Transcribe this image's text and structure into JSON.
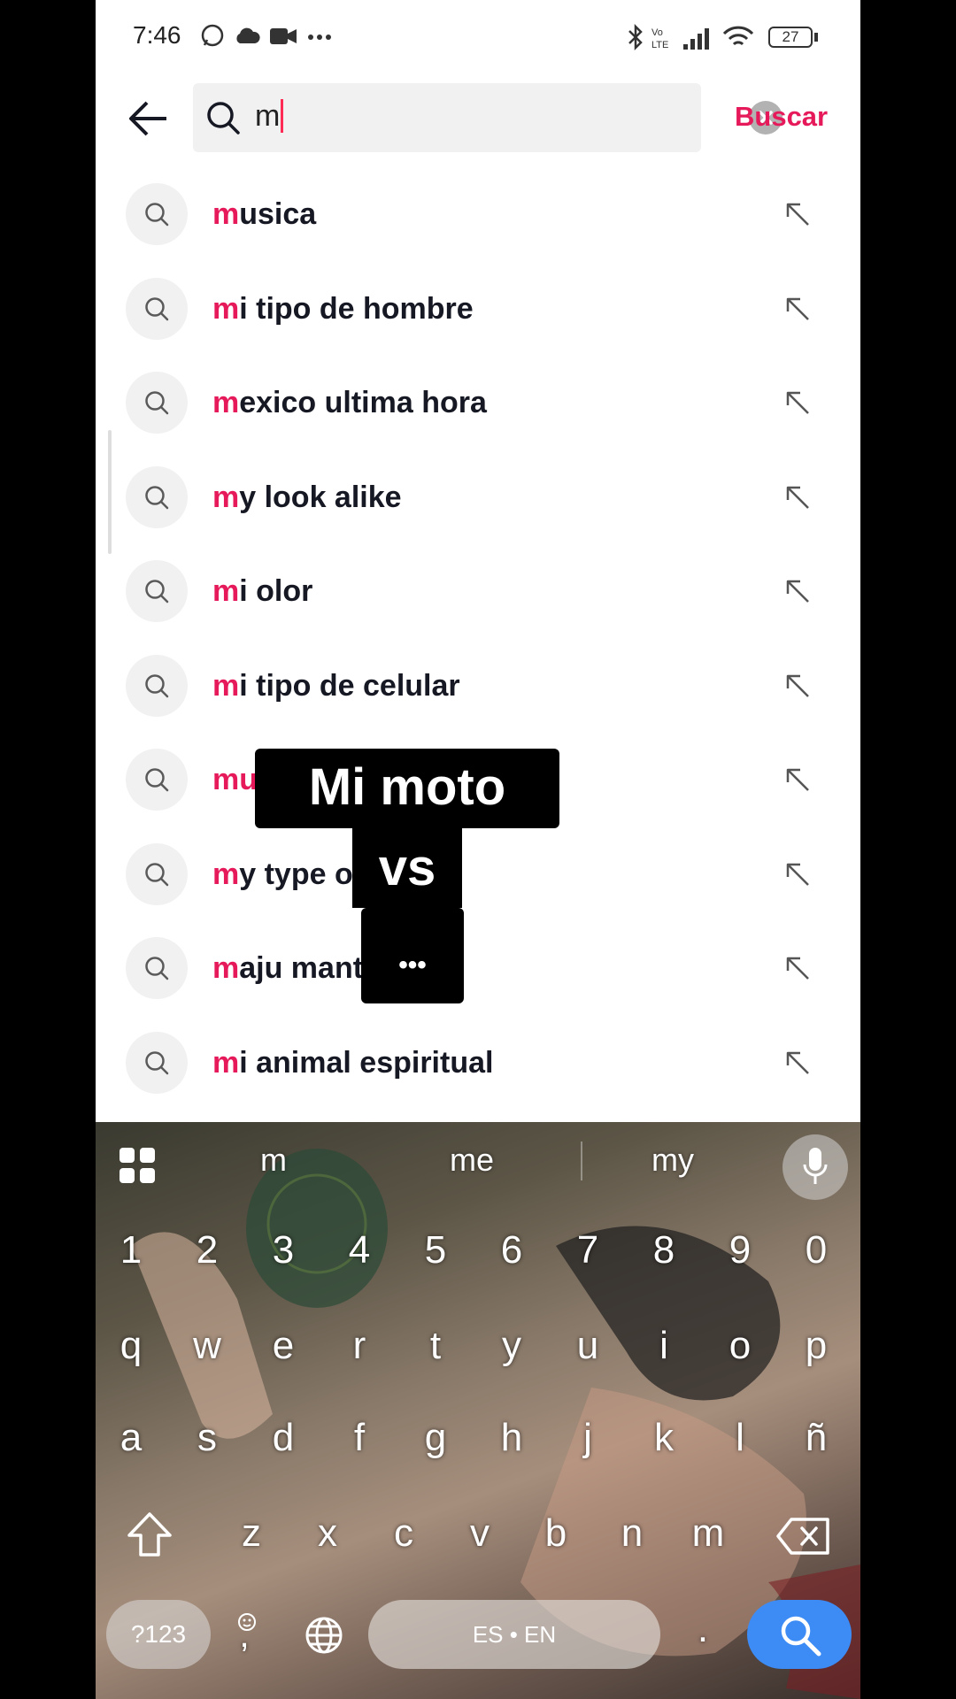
{
  "status_bar": {
    "time": "7:46",
    "battery": "27",
    "icons_left": [
      "whatsapp-icon",
      "cloud-icon",
      "video-icon",
      "more-icon"
    ],
    "icons_right": [
      "bluetooth-icon",
      "volte-icon",
      "signal-icon",
      "wifi-icon",
      "battery-icon"
    ]
  },
  "search": {
    "query": "m",
    "submit_label": "Buscar"
  },
  "suggestions": [
    {
      "hl": "m",
      "rest": "usica"
    },
    {
      "hl": "m",
      "rest": "i tipo de hombre"
    },
    {
      "hl": "m",
      "rest": "exico ultima hora"
    },
    {
      "hl": "m",
      "rest": "y look alike"
    },
    {
      "hl": "m",
      "rest": "i olor"
    },
    {
      "hl": "m",
      "rest": "i tipo de celular"
    },
    {
      "hl": "mu",
      "rest": ""
    },
    {
      "hl": "m",
      "rest": "y type of m"
    },
    {
      "hl": "m",
      "rest": "aju mantilla"
    },
    {
      "hl": "m",
      "rest": "i animal espiritual"
    }
  ],
  "overlay": {
    "line1": "Mi moto ideal",
    "line2": "vs",
    "line3": "•••"
  },
  "keyboard": {
    "suggestions": [
      "m",
      "me",
      "my"
    ],
    "numbers": [
      "1",
      "2",
      "3",
      "4",
      "5",
      "6",
      "7",
      "8",
      "9",
      "0"
    ],
    "row1": [
      "q",
      "w",
      "e",
      "r",
      "t",
      "y",
      "u",
      "i",
      "o",
      "p"
    ],
    "row2": [
      "a",
      "s",
      "d",
      "f",
      "g",
      "h",
      "j",
      "k",
      "l",
      "ñ"
    ],
    "row3": [
      "z",
      "x",
      "c",
      "v",
      "b",
      "n",
      "m"
    ],
    "symbols_label": "?123",
    "comma": ",",
    "space_label": "ES • EN",
    "period": "."
  },
  "colors": {
    "accent": "#e6195a",
    "search_key": "#3d8cf5"
  }
}
